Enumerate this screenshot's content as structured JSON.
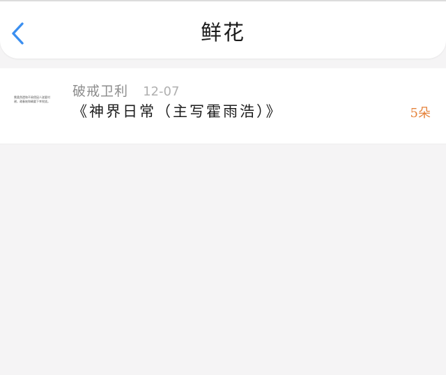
{
  "header": {
    "title": "鲜花",
    "back_icon": "chevron-left-icon",
    "accent_color": "#3b8ff0"
  },
  "flowers": {
    "items": [
      {
        "avatar_text_line1": "需柔然遗和不易侵因人遂要村",
        "avatar_text_line2": "谢，政春她和确要下幸吹拢。",
        "username": "破戒卫利",
        "date": "12-07",
        "book": "《神界日常（主写霍雨浩）》",
        "count": "5朵"
      }
    ],
    "count_color": "#e5823a"
  }
}
